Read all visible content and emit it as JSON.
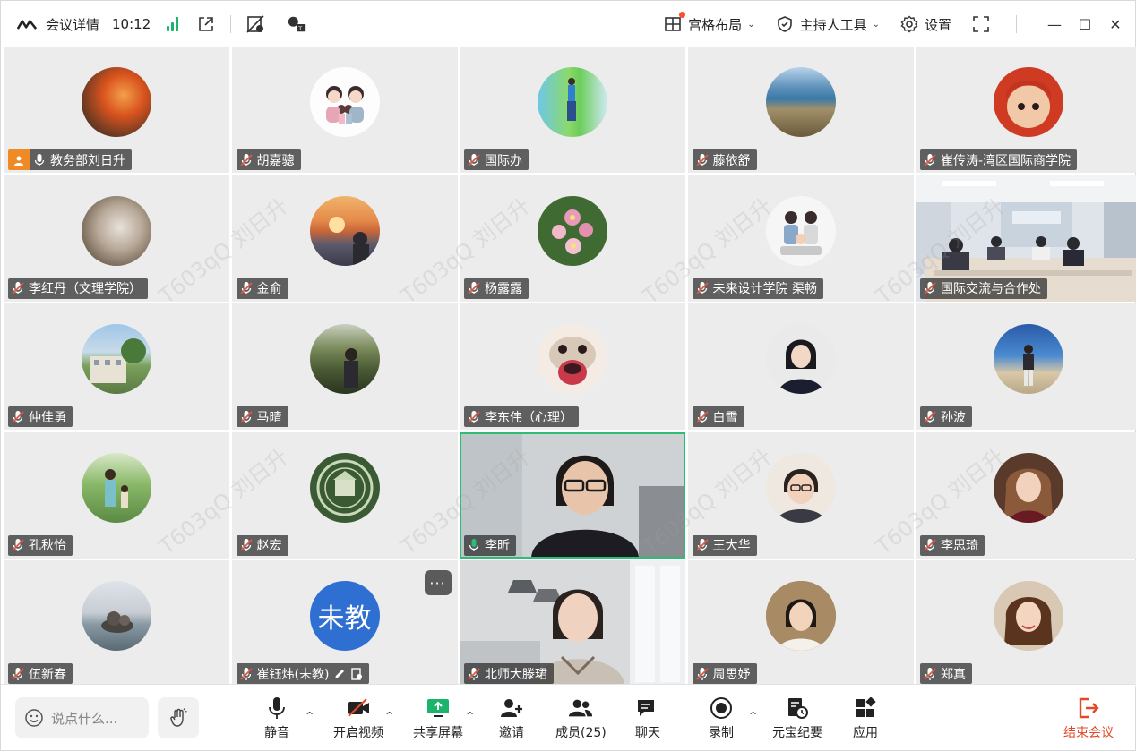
{
  "topbar": {
    "meeting_info": "会议详情",
    "time": "10:12",
    "layout_label": "宫格布局",
    "host_tools_label": "主持人工具",
    "settings_label": "设置"
  },
  "more_button": "···",
  "watermark": "T603qQ 刘日升",
  "participants": [
    {
      "name": "教务部刘日升"
    },
    {
      "name": "胡嘉骢"
    },
    {
      "name": "国际办"
    },
    {
      "name": "藤依舒"
    },
    {
      "name": "崔传涛-湾区国际商学院"
    },
    {
      "name": "李红丹（文理学院）"
    },
    {
      "name": "金俞"
    },
    {
      "name": "杨露露"
    },
    {
      "name": "未来设计学院 渠畅"
    },
    {
      "name": "国际交流与合作处"
    },
    {
      "name": "仲佳勇"
    },
    {
      "name": "马晴"
    },
    {
      "name": "李东伟（心理）"
    },
    {
      "name": "白雪"
    },
    {
      "name": "孙波"
    },
    {
      "name": "孔秋怡"
    },
    {
      "name": "赵宏"
    },
    {
      "name": "李昕"
    },
    {
      "name": "王大华"
    },
    {
      "name": "李思琦"
    },
    {
      "name": "伍新春"
    },
    {
      "name": "崔钰炜(未教)",
      "avatar_text": "未教"
    },
    {
      "name": "北师大滕珺"
    },
    {
      "name": "周思妤"
    },
    {
      "name": "郑真"
    }
  ],
  "toolbar": {
    "chat_placeholder": "说点什么...",
    "mute": "静音",
    "video": "开启视频",
    "share": "共享屏幕",
    "invite": "邀请",
    "members": "成员(25)",
    "chat": "聊天",
    "record": "录制",
    "minutes": "元宝纪要",
    "apps": "应用",
    "end": "结束会议"
  },
  "colors": {
    "accent_green": "#1cb46b",
    "end_red": "#e24a2a",
    "host_orange": "#f08a24",
    "text_avatar_blue": "#2e6fd1"
  }
}
